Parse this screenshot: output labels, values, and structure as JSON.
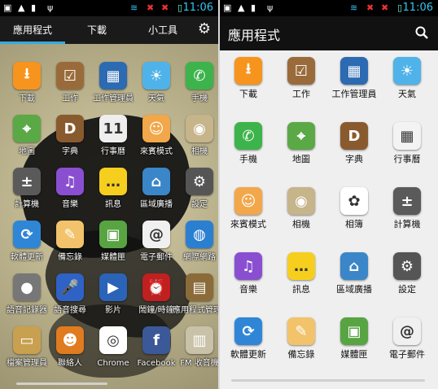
{
  "status": {
    "time": "11:06"
  },
  "left": {
    "tabs": [
      "應用程式",
      "下載",
      "小工具"
    ],
    "apps": [
      {
        "label": "下載",
        "icon": "download-icon",
        "color": "#f7941d",
        "glyph": "⭳"
      },
      {
        "label": "工作",
        "icon": "tasks-icon",
        "color": "#9a6b3a",
        "glyph": "☑"
      },
      {
        "label": "工作管理員",
        "icon": "task-manager-icon",
        "color": "#2c6ab2",
        "glyph": "▦"
      },
      {
        "label": "天氣",
        "icon": "weather-icon",
        "color": "#4fb3ea",
        "glyph": "☀"
      },
      {
        "label": "手機",
        "icon": "phone-icon",
        "color": "#3cb44b",
        "glyph": "✆"
      },
      {
        "label": "地圖",
        "icon": "maps-icon",
        "color": "#5ba847",
        "glyph": "⌖"
      },
      {
        "label": "字典",
        "icon": "dictionary-icon",
        "color": "#8a5a2f",
        "glyph": "D"
      },
      {
        "label": "行事曆",
        "icon": "calendar-icon",
        "color": "#eeeeee",
        "glyph": "11"
      },
      {
        "label": "來賓模式",
        "icon": "guest-mode-icon",
        "color": "#f2a74a",
        "glyph": "☺"
      },
      {
        "label": "相機",
        "icon": "camera-icon",
        "color": "#c6b48a",
        "glyph": "◉"
      },
      {
        "label": "計算機",
        "icon": "calculator-icon",
        "color": "#5a5a5a",
        "glyph": "±"
      },
      {
        "label": "音樂",
        "icon": "music-icon",
        "color": "#8a4fd1",
        "glyph": "♫"
      },
      {
        "label": "訊息",
        "icon": "messaging-icon",
        "color": "#f6cf1e",
        "glyph": "…"
      },
      {
        "label": "區域廣播",
        "icon": "area-broadcast-icon",
        "color": "#3a86c8",
        "glyph": "⌂"
      },
      {
        "label": "設定",
        "icon": "settings-icon",
        "color": "#555555",
        "glyph": "⚙"
      },
      {
        "label": "軟體更新",
        "icon": "software-update-icon",
        "color": "#2f86d6",
        "glyph": "⟳"
      },
      {
        "label": "備忘錄",
        "icon": "memo-icon",
        "color": "#f2c36b",
        "glyph": "✎"
      },
      {
        "label": "媒體匣",
        "icon": "gallery-icon",
        "color": "#58a442",
        "glyph": "▣"
      },
      {
        "label": "電子郵件",
        "icon": "email-icon",
        "color": "#f0f0f0",
        "glyph": "@"
      },
      {
        "label": "網際網路",
        "icon": "browser-icon",
        "color": "#2b7fd1",
        "glyph": "◍"
      },
      {
        "label": "語音記錄器",
        "icon": "voice-recorder-icon",
        "color": "#777777",
        "glyph": "●"
      },
      {
        "label": "語音搜尋",
        "icon": "voice-search-icon",
        "color": "#2f62c5",
        "glyph": "🎤"
      },
      {
        "label": "影片",
        "icon": "video-icon",
        "color": "#2b63b8",
        "glyph": "▶"
      },
      {
        "label": "鬧鐘/時鐘",
        "icon": "alarm-clock-icon",
        "color": "#c02020",
        "glyph": "⏰"
      },
      {
        "label": "應用程式管理員",
        "icon": "app-manager-icon",
        "color": "#8b6b3a",
        "glyph": "▤"
      },
      {
        "label": "檔案管理員",
        "icon": "file-manager-icon",
        "color": "#c8a050",
        "glyph": "▭"
      },
      {
        "label": "聯絡人",
        "icon": "contacts-icon",
        "color": "#e07b1f",
        "glyph": "☻"
      },
      {
        "label": "Chrome",
        "icon": "chrome-icon",
        "color": "#ffffff",
        "glyph": "◎"
      },
      {
        "label": "Facebook",
        "icon": "facebook-icon",
        "color": "#3b5998",
        "glyph": "f"
      },
      {
        "label": "FM 收音機",
        "icon": "fm-radio-icon",
        "color": "#c9c1a8",
        "glyph": "▥"
      }
    ]
  },
  "right": {
    "title": "應用程式",
    "apps": [
      {
        "label": "下載",
        "icon": "download-icon",
        "color": "#f7941d",
        "glyph": "⭳"
      },
      {
        "label": "工作",
        "icon": "tasks-icon",
        "color": "#9a6b3a",
        "glyph": "☑"
      },
      {
        "label": "工作管理員",
        "icon": "task-manager-icon",
        "color": "#2c6ab2",
        "glyph": "▦"
      },
      {
        "label": "天氣",
        "icon": "weather-icon",
        "color": "#4fb3ea",
        "glyph": "☀"
      },
      {
        "label": "手機",
        "icon": "phone-icon",
        "color": "#3cb44b",
        "glyph": "✆"
      },
      {
        "label": "地圖",
        "icon": "maps-icon",
        "color": "#5ba847",
        "glyph": "⌖"
      },
      {
        "label": "字典",
        "icon": "dictionary-icon",
        "color": "#8a5a2f",
        "glyph": "D"
      },
      {
        "label": "行事曆",
        "icon": "calendar-icon",
        "color": "#f3f3f3",
        "glyph": "▦"
      },
      {
        "label": "來賓模式",
        "icon": "guest-mode-icon",
        "color": "#f2a74a",
        "glyph": "☺"
      },
      {
        "label": "相機",
        "icon": "camera-icon",
        "color": "#c6b48a",
        "glyph": "◉"
      },
      {
        "label": "相簿",
        "icon": "photos-icon",
        "color": "#ffffff",
        "glyph": "✿"
      },
      {
        "label": "計算機",
        "icon": "calculator-icon",
        "color": "#5a5a5a",
        "glyph": "±"
      },
      {
        "label": "音樂",
        "icon": "music-icon",
        "color": "#8a4fd1",
        "glyph": "♫"
      },
      {
        "label": "訊息",
        "icon": "messaging-icon",
        "color": "#f6cf1e",
        "glyph": "…"
      },
      {
        "label": "區域廣播",
        "icon": "area-broadcast-icon",
        "color": "#3a86c8",
        "glyph": "⌂"
      },
      {
        "label": "設定",
        "icon": "settings-icon",
        "color": "#555555",
        "glyph": "⚙"
      },
      {
        "label": "軟體更新",
        "icon": "software-update-icon",
        "color": "#2f86d6",
        "glyph": "⟳"
      },
      {
        "label": "備忘錄",
        "icon": "memo-icon",
        "color": "#f2c36b",
        "glyph": "✎"
      },
      {
        "label": "媒體匣",
        "icon": "gallery-icon",
        "color": "#58a442",
        "glyph": "▣"
      },
      {
        "label": "電子郵件",
        "icon": "email-icon",
        "color": "#f0f0f0",
        "glyph": "@"
      }
    ]
  }
}
